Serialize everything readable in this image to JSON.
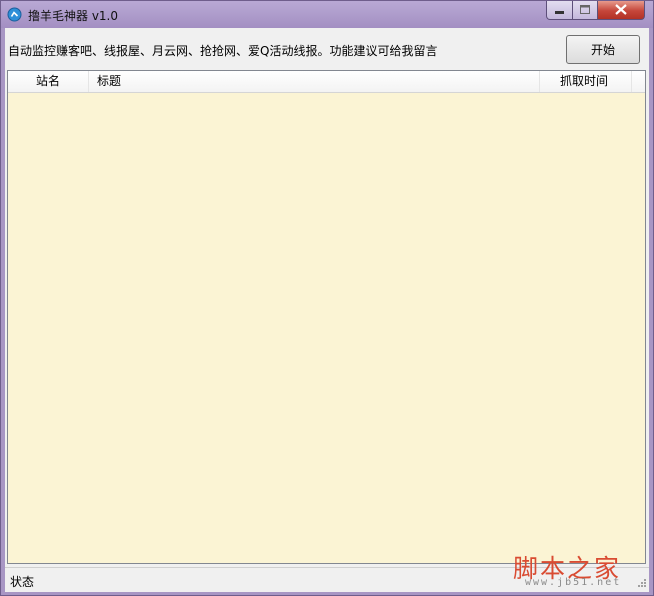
{
  "window": {
    "title": "撸羊毛神器 v1.0",
    "controls": {
      "minimize": "–",
      "maximize": "□",
      "close": "✕"
    }
  },
  "toolbar": {
    "notice": "自动监控赚客吧、线报屋、月云网、抢抢网、爱Q活动线报。功能建议可给我留言",
    "start_label": "开始"
  },
  "list": {
    "columns": [
      "站名",
      "标题",
      "抓取时间"
    ],
    "rows": []
  },
  "status": {
    "text": "状态"
  },
  "watermark": {
    "text": "脚本之家",
    "url": "www.jb51.net"
  },
  "colors": {
    "titlebar": "#a896c4",
    "list_background": "#fbf4d4",
    "close_button": "#c5463a",
    "watermark": "#d94b32"
  }
}
